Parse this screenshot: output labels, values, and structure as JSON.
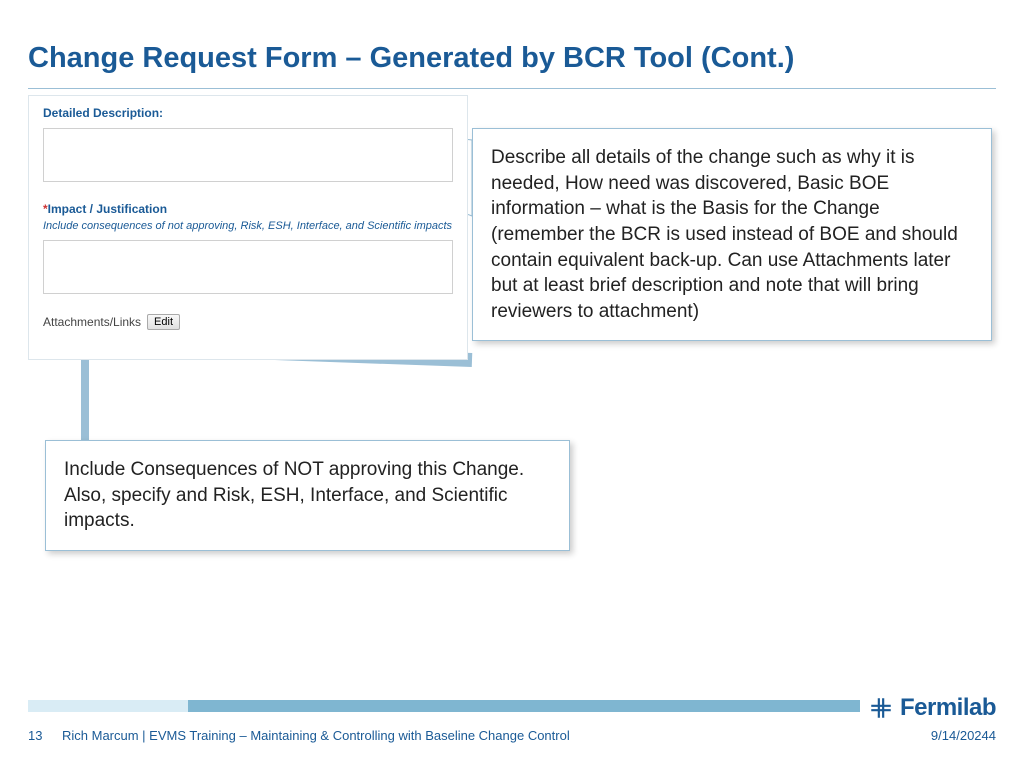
{
  "title": "Change Request Form – Generated by BCR Tool (Cont.)",
  "form": {
    "detailed_label": "Detailed Description:",
    "impact_asterisk": "*",
    "impact_label": "Impact / Justification",
    "impact_note": "Include consequences of not approving, Risk, ESH, Interface, and Scientific impacts",
    "attachments_label": "Attachments/Links",
    "edit_button": "Edit"
  },
  "callouts": {
    "describe": "Describe all details of the change such as why it is needed, How need was discovered, Basic BOE information – what is the Basis for the Change (remember the BCR is used instead of BOE and should contain equivalent back-up. Can use Attachments later but at least brief description and note that will bring reviewers to attachment)",
    "consequences": "Include Consequences of NOT approving this Change. Also, specify and Risk, ESH, Interface, and Scientific impacts."
  },
  "footer": {
    "page": "13",
    "line": "Rich Marcum | EVMS Training – Maintaining & Controlling with Baseline Change Control",
    "date": "9/14/20244"
  },
  "logo_text": "Fermilab"
}
